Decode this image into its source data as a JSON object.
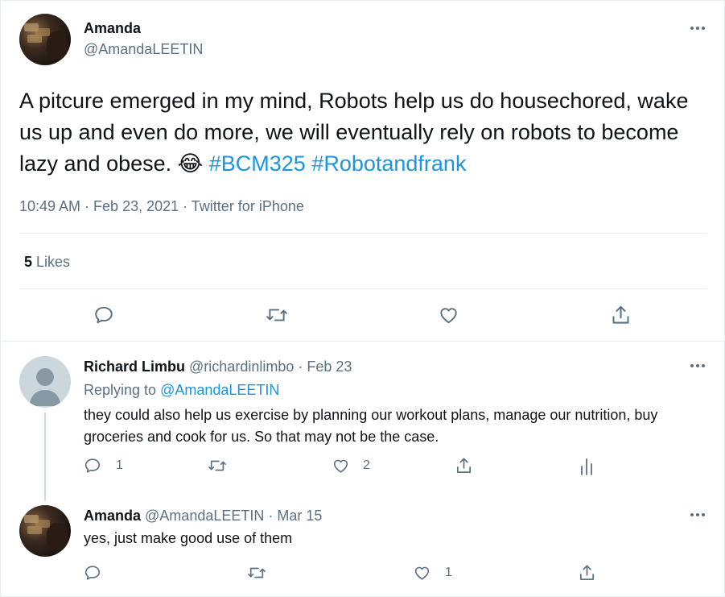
{
  "main_tweet": {
    "name": "Amanda",
    "handle": "@AmandaLEETIN",
    "text_before": "A pitcure emerged in my mind, Robots help us do housechored, wake us up and even do more, we will eventually rely on robots to become lazy and obese. ",
    "emoji": "😂",
    "hashtag1": "#BCM325",
    "hashtag2": "#Robotandfrank",
    "meta": "10:49 AM · Feb 23, 2021 · Twitter for iPhone",
    "likes_count": "5",
    "likes_label": "Likes"
  },
  "reply1": {
    "name": "Richard Limbu",
    "handle": "@richardinlimbo",
    "dot": "·",
    "date": "Feb 23",
    "replying_label": "Replying to",
    "replying_handle": "@AmandaLEETIN",
    "text": "they could also help us exercise by planning our workout plans, manage our nutrition, buy groceries and cook for us. So that may not be the case.",
    "reply_count": "1",
    "like_count": "2"
  },
  "reply2": {
    "name": "Amanda",
    "handle": "@AmandaLEETIN",
    "dot": "·",
    "date": "Mar 15",
    "text": "yes, just make good use of them",
    "like_count": "1"
  },
  "colors": {
    "accent": "#1b95e0",
    "muted": "#5b7083",
    "divider": "#e6ecf0"
  },
  "icons": [
    "reply-icon",
    "retweet-icon",
    "like-icon",
    "share-icon",
    "analytics-icon",
    "more-icon"
  ]
}
